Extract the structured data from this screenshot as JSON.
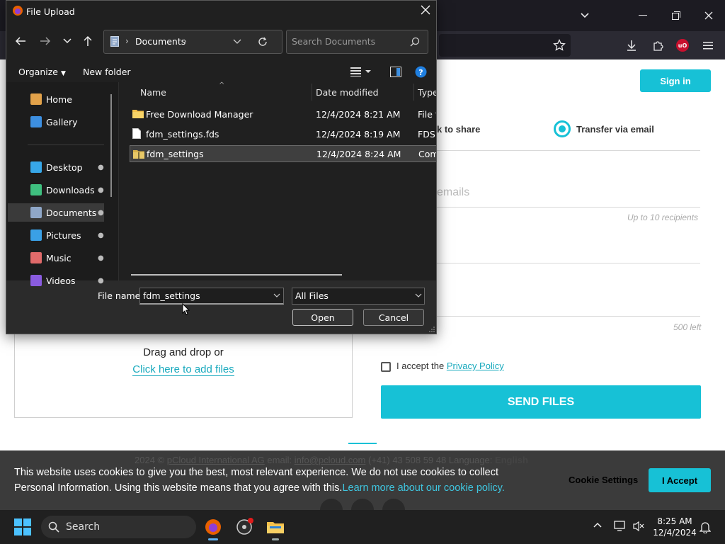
{
  "browser": {
    "ublock_badge": "uO"
  },
  "page": {
    "signin_label": "Sign in",
    "radio_share_label": "k to share",
    "radio_email_label": "Transfer via email",
    "emails_placeholder": "emails",
    "recipients_hint": "Up to 10 recipients",
    "chars_left": "500 left",
    "drag_text": "Drag and drop or",
    "click_add": "Click here to add files",
    "accept_prefix": "I accept the ",
    "privacy_link": "Privacy Policy",
    "send_button": "SEND FILES",
    "footer": {
      "year": "2024 ©",
      "company": "pCloud International AG",
      "email_label": "email:",
      "email": "info@pcloud.com",
      "phone": "(+41) 43 508 59 48",
      "language_label": "Language:",
      "language": "English"
    }
  },
  "cookie": {
    "text": "This website uses cookies to give you the best, most relevant experience. We do not use cookies to collect Personal Information. Using this website means that you agree with this.",
    "link": "Learn more about our cookie policy.",
    "settings": "Cookie Settings",
    "accept": "I Accept"
  },
  "dialog": {
    "title": "File Upload",
    "path": "Documents",
    "search_placeholder": "Search Documents",
    "organize": "Organize",
    "new_folder": "New folder",
    "nav_items": [
      {
        "label": "Home",
        "icon": "home-icon",
        "color": "#e2a24a"
      },
      {
        "label": "Gallery",
        "icon": "gallery-icon",
        "color": "#3d8fe0"
      },
      {
        "label": "Desktop",
        "icon": "desktop-icon",
        "color": "#37a7e8"
      },
      {
        "label": "Downloads",
        "icon": "downloads-icon",
        "color": "#3fbf7f"
      },
      {
        "label": "Documents",
        "icon": "documents-icon",
        "color": "#8fa7c8"
      },
      {
        "label": "Pictures",
        "icon": "pictures-icon",
        "color": "#3aa0e6"
      },
      {
        "label": "Music",
        "icon": "music-icon",
        "color": "#e06a6a"
      },
      {
        "label": "Videos",
        "icon": "videos-icon",
        "color": "#8a5ce0"
      }
    ],
    "columns": {
      "name": "Name",
      "date": "Date modified",
      "type": "Type"
    },
    "files": [
      {
        "name": "Free Download Manager",
        "date": "12/4/2024 8:21 AM",
        "type": "File folder",
        "icon": "folder-icon"
      },
      {
        "name": "fdm_settings.fds",
        "date": "12/4/2024 8:19 AM",
        "type": "FDS File",
        "icon": "file-icon"
      },
      {
        "name": "fdm_settings",
        "date": "12/4/2024 8:24 AM",
        "type": "Compressed",
        "icon": "zip-folder-icon"
      }
    ],
    "file_name_label": "File name:",
    "file_name_value": "fdm_settings",
    "file_type_value": "All Files",
    "open_label": "Open",
    "cancel_label": "Cancel"
  },
  "taskbar": {
    "search_label": "Search",
    "time": "8:25 AM",
    "date": "12/4/2024"
  },
  "colors": {
    "accent": "#17c1d6",
    "dialog_bg": "#202020",
    "taskbar_bg": "#202020"
  }
}
